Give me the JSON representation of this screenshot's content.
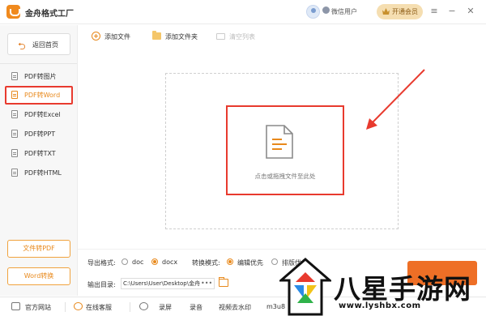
{
  "app": {
    "title": "金舟格式工厂"
  },
  "user": {
    "name": "微信用户"
  },
  "vip": {
    "label": "开通会员"
  },
  "window_controls": {
    "menu": "≡",
    "minimize": "−",
    "close": "✕"
  },
  "sidebar": {
    "home_label": "返回首页",
    "items": [
      {
        "label": "PDF转图片",
        "active": false
      },
      {
        "label": "PDF转Word",
        "active": true
      },
      {
        "label": "PDF转Excel",
        "active": false
      },
      {
        "label": "PDF转PPT",
        "active": false
      },
      {
        "label": "PDF转TXT",
        "active": false
      },
      {
        "label": "PDF转HTML",
        "active": false
      }
    ],
    "bottom_buttons": [
      "文件转PDF",
      "Word转换"
    ]
  },
  "toolbar": {
    "add_file": "添加文件",
    "add_folder": "添加文件夹",
    "clear_list": "清空列表"
  },
  "dropzone": {
    "hint": "点击或拖拽文件至此处"
  },
  "settings": {
    "export_format_label": "导出格式:",
    "formats": [
      {
        "label": "doc",
        "selected": false
      },
      {
        "label": "docx",
        "selected": true
      }
    ],
    "mode_label": "转换模式:",
    "modes": [
      {
        "label": "编辑优先",
        "selected": true
      },
      {
        "label": "排版优先",
        "selected": false
      }
    ],
    "output_dir_label": "输出目录:",
    "output_dir_value": "C:\\Users\\User\\Desktop\\金舟"
  },
  "statusbar": {
    "items": [
      "官方网站",
      "在线客服",
      "录屏",
      "录音",
      "视频去水印",
      "m3u8"
    ]
  },
  "watermark": {
    "text": "八星手游网",
    "url": "www.lyshbx.com"
  },
  "colors": {
    "accent": "#e8891c",
    "highlight": "#e83a2e",
    "start": "#ee6f26"
  }
}
